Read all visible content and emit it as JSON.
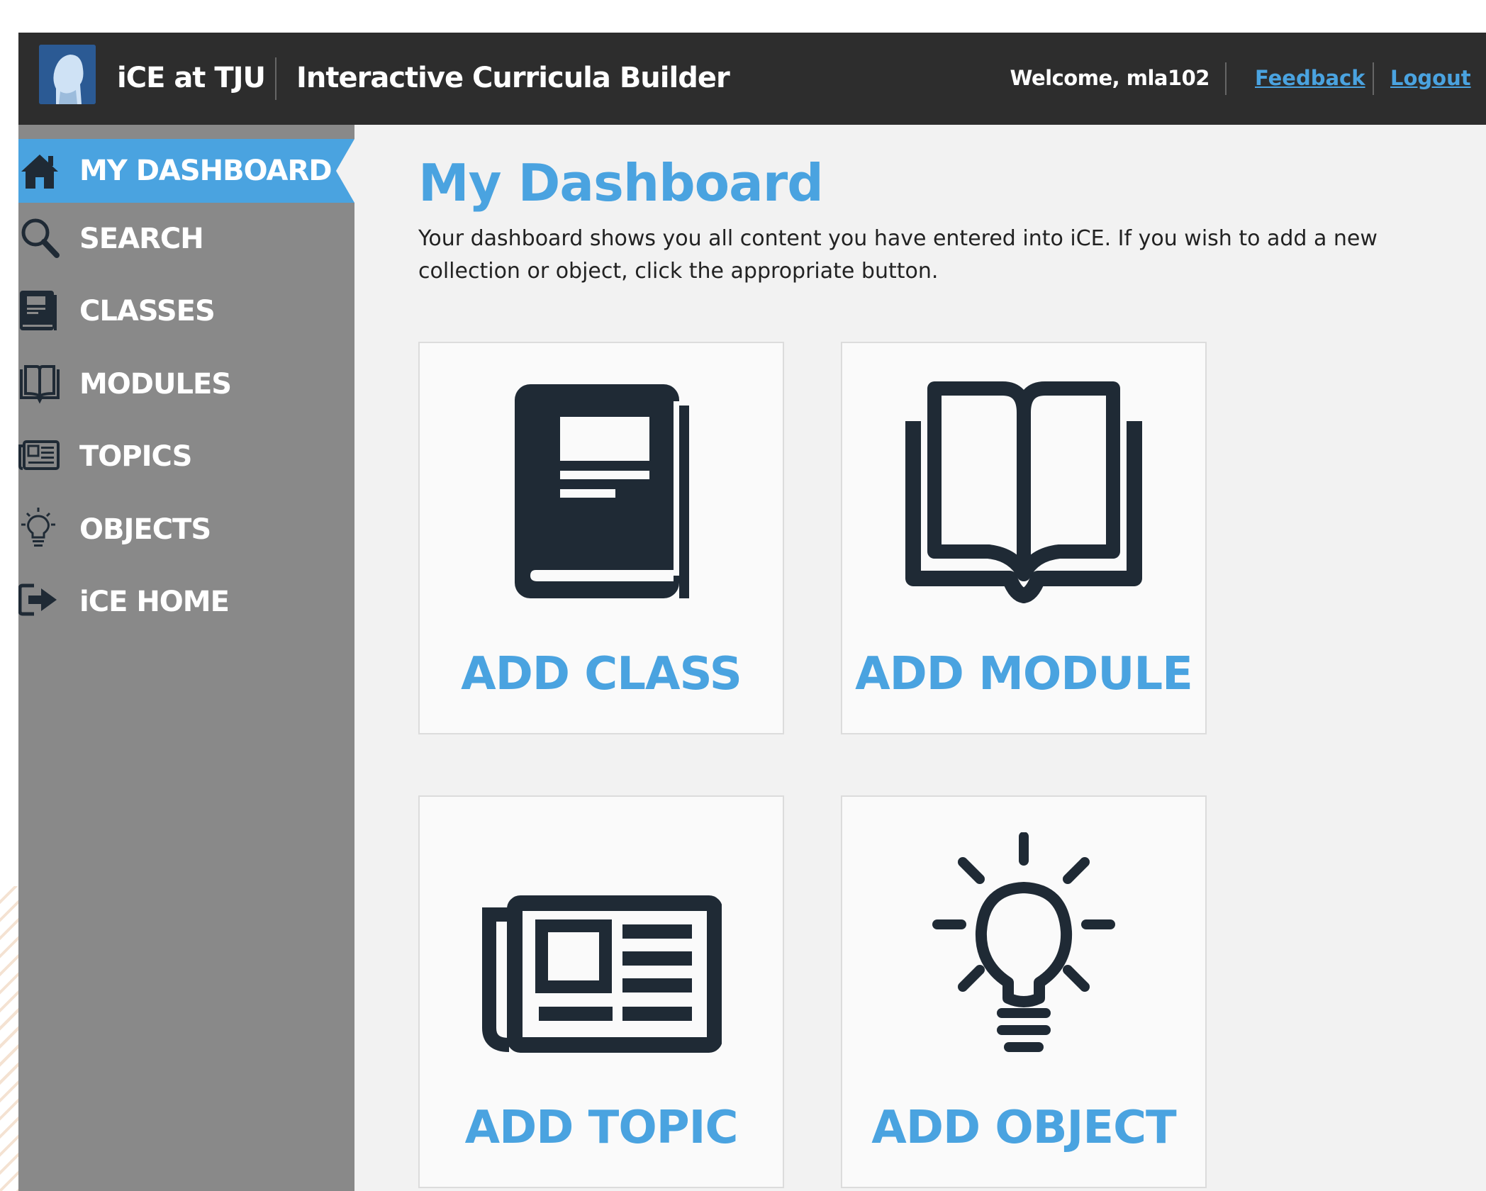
{
  "header": {
    "app_name": "iCE at TJU",
    "subtitle": "Interactive Curricula Builder",
    "welcome": "Welcome, mla102",
    "feedback_link": "Feedback",
    "logout_link": "Logout"
  },
  "sidebar": {
    "items": [
      {
        "label": "MY DASHBOARD",
        "icon": "home-icon",
        "active": true
      },
      {
        "label": "SEARCH",
        "icon": "search-icon",
        "active": false
      },
      {
        "label": "CLASSES",
        "icon": "book-icon",
        "active": false
      },
      {
        "label": "MODULES",
        "icon": "open-book-icon",
        "active": false
      },
      {
        "label": "TOPICS",
        "icon": "newspaper-icon",
        "active": false
      },
      {
        "label": "OBJECTS",
        "icon": "lightbulb-icon",
        "active": false
      },
      {
        "label": "iCE HOME",
        "icon": "exit-icon",
        "active": false
      }
    ]
  },
  "main": {
    "title": "My Dashboard",
    "intro": "Your dashboard shows you all content you have entered into iCE. If you wish to add a new collection or object, click the appropriate button.",
    "cards": [
      {
        "label": "ADD CLASS",
        "icon": "book-icon"
      },
      {
        "label": "ADD MODULE",
        "icon": "open-book-icon"
      },
      {
        "label": "ADD TOPIC",
        "icon": "newspaper-icon"
      },
      {
        "label": "ADD OBJECT",
        "icon": "lightbulb-icon"
      }
    ]
  },
  "colors": {
    "accent": "#4aa3e0",
    "header_bg": "#2d2d2d",
    "sidebar_bg": "#898989",
    "content_bg": "#f2f2f2",
    "icon_dark": "#1f2a35"
  }
}
